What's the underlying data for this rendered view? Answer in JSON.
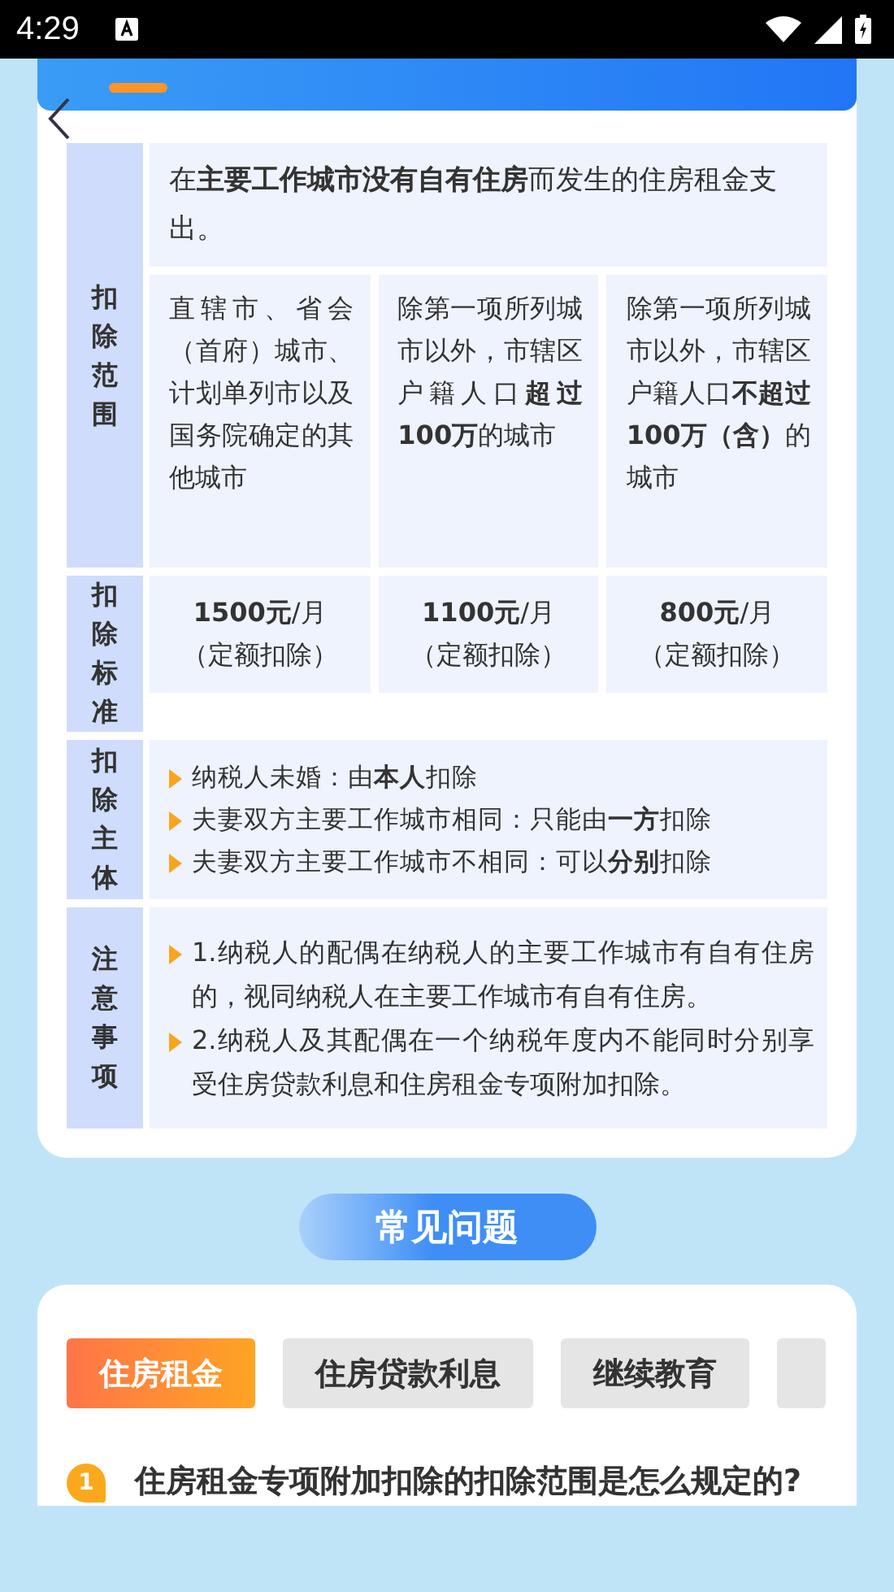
{
  "status_bar": {
    "time": "4:29"
  },
  "table": {
    "rows": [
      {
        "kind": "scope",
        "label": "扣除范围",
        "intro": "在**主要工作城市没有自有住房**而发生的住房租金支出。",
        "cells": [
          "直辖市、省会（首府）城市、计划单列市以及国务院确定的其他城市",
          "除第一项所列城市以外，市辖区户籍人口**超过100万**的城市",
          "除第一项所列城市以外，市辖区户籍人口**不超过100万（含）**的城市"
        ]
      },
      {
        "kind": "standard",
        "label": "扣除标准",
        "cells": [
          {
            "amount": "**1500元**/月",
            "note": "（定额扣除）"
          },
          {
            "amount": "**1100元**/月",
            "note": "（定额扣除）"
          },
          {
            "amount": "**800元**/月",
            "note": "（定额扣除）"
          }
        ]
      },
      {
        "kind": "bullets",
        "label": "扣除主体",
        "items": [
          "纳税人未婚：由**本人**扣除",
          "夫妻双方主要工作城市相同：只能由**一方**扣除",
          "夫妻双方主要工作城市不相同：可以**分别**扣除"
        ]
      },
      {
        "kind": "notes",
        "label": "注意事项",
        "items": [
          "1.纳税人的配偶在纳税人的主要工作城市有自有住房的，视同纳税人在主要工作城市有自有住房。",
          "2.纳税人及其配偶在一个纳税年度内不能同时分别享受住房贷款利息和住房租金专项附加扣除。"
        ]
      }
    ]
  },
  "faq": {
    "title": "常见问题",
    "tabs": [
      {
        "label": "住房租金",
        "selected": true
      },
      {
        "label": "住房贷款利息",
        "selected": false
      },
      {
        "label": "继续教育",
        "selected": false
      }
    ],
    "questions": [
      {
        "number": "1",
        "text": "住房租金专项附加扣除的扣除范围是怎么规定的?"
      }
    ]
  }
}
